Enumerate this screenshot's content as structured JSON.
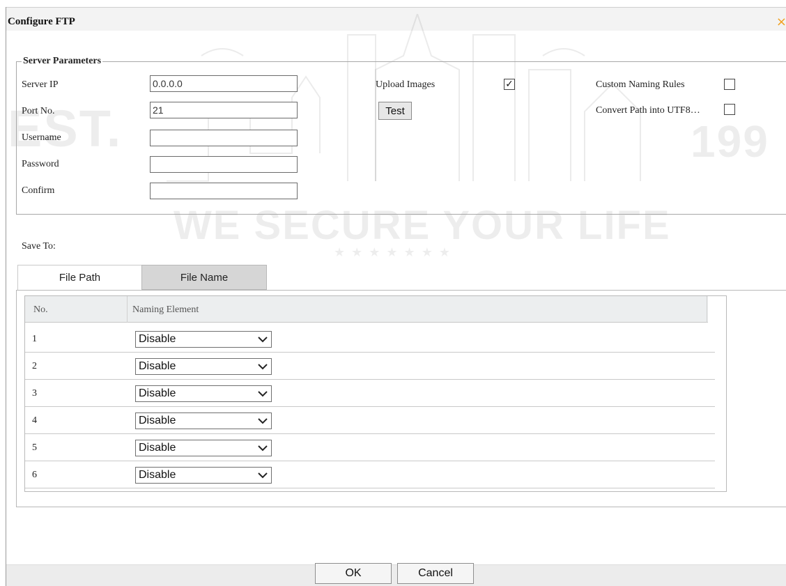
{
  "dialog": {
    "title": "Configure FTP",
    "close_glyph": "×"
  },
  "server": {
    "legend": "Server Parameters",
    "labels": {
      "ip": "Server IP",
      "port": "Port No.",
      "username": "Username",
      "password": "Password",
      "confirm": "Confirm"
    },
    "values": {
      "ip": "0.0.0.0",
      "port": "21",
      "username": "",
      "password": "",
      "confirm": ""
    },
    "upload_images_label": "Upload Images",
    "upload_images_checked": true,
    "test_button": "Test",
    "custom_naming_label": "Custom Naming Rules",
    "custom_naming_checked": false,
    "utf8_label": "Convert Path into UTF8…",
    "utf8_checked": false,
    "checkmark": "✓"
  },
  "save_to": "Save To:",
  "tabs": [
    {
      "label": "File Path",
      "active": true
    },
    {
      "label": "File Name",
      "active": false
    }
  ],
  "table": {
    "headers": [
      "No.",
      "Naming Element"
    ],
    "rows": [
      {
        "no": "1",
        "element": "Disable"
      },
      {
        "no": "2",
        "element": "Disable"
      },
      {
        "no": "3",
        "element": "Disable"
      },
      {
        "no": "4",
        "element": "Disable"
      },
      {
        "no": "5",
        "element": "Disable"
      },
      {
        "no": "6",
        "element": "Disable"
      }
    ]
  },
  "buttons": {
    "ok": "OK",
    "cancel": "Cancel"
  },
  "watermark": {
    "left": "EST.",
    "right": "199",
    "center": "WE SECURE YOUR LIFE",
    "stars": "★ ★ ★ ★ ★ ★ ★"
  },
  "colors": {
    "close": "#f0a020",
    "footer": "#ececec",
    "inactive_tab": "#d6d6d6",
    "table_header": "#eceeef"
  }
}
